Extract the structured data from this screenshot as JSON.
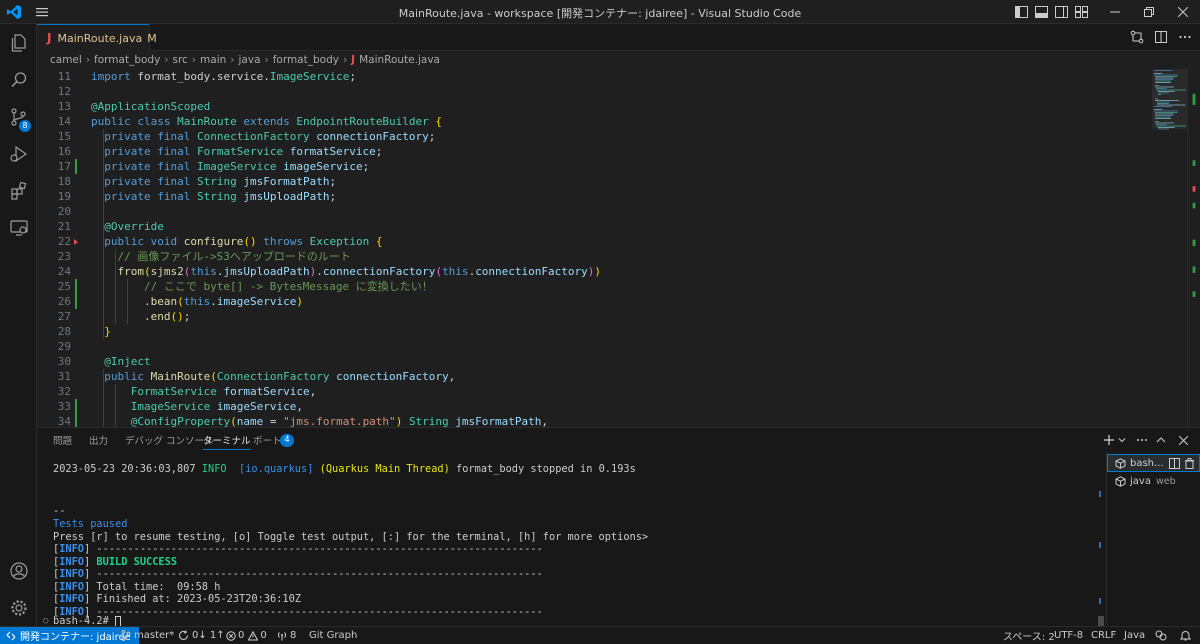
{
  "window": {
    "title": "MainRoute.java - workspace [開発コンテナー: jdairee] - Visual Studio Code"
  },
  "activity": {
    "scm_badge": "8"
  },
  "tab": {
    "icon_letter": "J",
    "name": "MainRoute.java",
    "modified": "M"
  },
  "breadcrumb": [
    "camel",
    "format_body",
    "src",
    "main",
    "java",
    "format_body",
    "MainRoute.java"
  ],
  "breadcrumb_file_icon": "J",
  "editor": {
    "lines": [
      {
        "n": "11",
        "text": "import format_body.service.ImageService;"
      },
      {
        "n": "12",
        "text": ""
      },
      {
        "n": "13",
        "text": "@ApplicationScoped"
      },
      {
        "n": "14",
        "text": "public class MainRoute extends EndpointRouteBuilder {"
      },
      {
        "n": "15",
        "text": "  private final ConnectionFactory connectionFactory;"
      },
      {
        "n": "16",
        "text": "  private final FormatService formatService;"
      },
      {
        "n": "17",
        "text": "  private final ImageService imageService;"
      },
      {
        "n": "18",
        "text": "  private final String jmsFormatPath;"
      },
      {
        "n": "19",
        "text": "  private final String jmsUploadPath;"
      },
      {
        "n": "20",
        "text": ""
      },
      {
        "n": "21",
        "text": "  @Override"
      },
      {
        "n": "22",
        "text": "  public void configure() throws Exception {"
      },
      {
        "n": "23",
        "text": "    // 画像ファイル->S3へアップロードのルート"
      },
      {
        "n": "24",
        "text": "    from(sjms2(this.jmsUploadPath).connectionFactory(this.connectionFactory))"
      },
      {
        "n": "25",
        "text": "        // ここで byte[] -> BytesMessage に変換したい！"
      },
      {
        "n": "26",
        "text": "        .bean(this.imageService)"
      },
      {
        "n": "27",
        "text": "        .end();"
      },
      {
        "n": "28",
        "text": "  }"
      },
      {
        "n": "29",
        "text": ""
      },
      {
        "n": "30",
        "text": "  @Inject"
      },
      {
        "n": "31",
        "text": "  public MainRoute(ConnectionFactory connectionFactory,"
      },
      {
        "n": "32",
        "text": "      FormatService formatService,"
      },
      {
        "n": "33",
        "text": "      ImageService imageService,"
      },
      {
        "n": "34",
        "text": "      @ConfigProperty(name = \"jms.format.path\") String jmsFormatPath,"
      }
    ]
  },
  "panel": {
    "tabs": [
      "問題",
      "出力",
      "デバッグ コンソール",
      "ターミナル",
      "ポート"
    ],
    "active_tab": "ターミナル",
    "ports_badge": "4",
    "terminal_lines": {
      "l1_date": "2023-05-23 20:36:03,807",
      "l1_level": "INFO",
      "l1_logger": "[io.quarkus]",
      "l1_thread": "(Quarkus Main Thread)",
      "l1_msg": "format_body stopped in 0.193s",
      "dashes": "--",
      "paused": "Tests paused",
      "press": "Press [r] to resume testing, [o] Toggle test output, [:] for the terminal, [h] for more options>",
      "info": "INFO",
      "rule": " ------------------------------------------------------------------------",
      "build": "BUILD SUCCESS",
      "total": " Total time:  09:58 h",
      "finished": " Finished at: 2023-05-23T20:36:10Z",
      "prompt": "bash-4.2# "
    },
    "terminals": [
      {
        "name": "bash...",
        "sub": ""
      },
      {
        "name": "java",
        "sub": "web"
      }
    ]
  },
  "status": {
    "remote": "開発コンテナー: jdairee",
    "branch": "master*",
    "sync": "0↓ 1↑",
    "errors": "0",
    "warnings": "0",
    "ports": "8",
    "gitgraph": "Git Graph",
    "spaces": "スペース: 2",
    "encoding": "UTF-8",
    "eol": "CRLF",
    "lang": "Java"
  },
  "colors": {
    "accent": "#0078d4",
    "added": "#2ea043",
    "deleted": "#f14c4c"
  }
}
